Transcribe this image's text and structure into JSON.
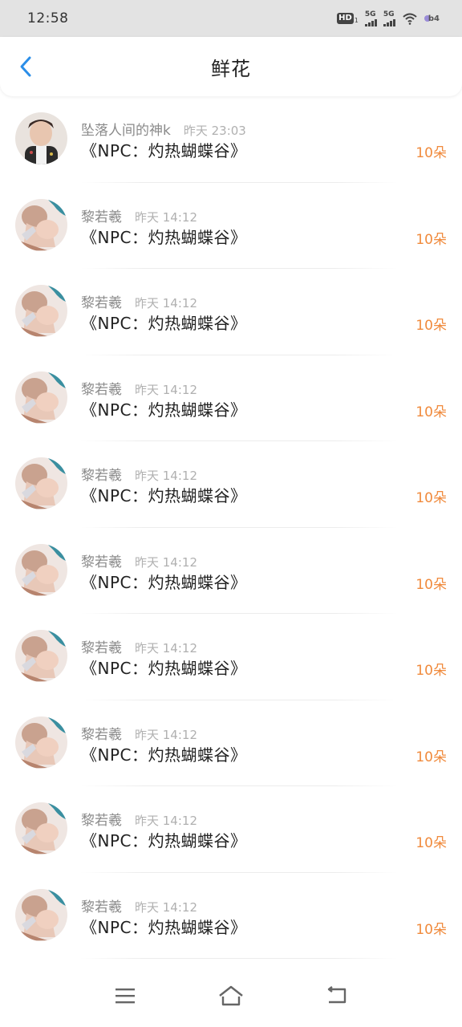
{
  "status_bar": {
    "time": "12:58",
    "hd_label": "HD",
    "hd_sub": "1",
    "signal1_label": "5G",
    "signal2_label": "5G",
    "battery_label": "b4"
  },
  "header": {
    "title": "鲜花",
    "back_icon": "chevron-left-icon"
  },
  "colors": {
    "accent_blue": "#2b8ee8",
    "count_orange": "#f08a3c",
    "username_gray": "#8a8a8a",
    "time_gray": "#b0b0b0"
  },
  "items": [
    {
      "username": "坠落人间的神k",
      "time": "昨天 23:03",
      "text": "《NPC：灼热蝴蝶谷》",
      "count": "10朵",
      "avatar": "avatar-1"
    },
    {
      "username": "黎若羲",
      "time": "昨天 14:12",
      "text": "《NPC：灼热蝴蝶谷》",
      "count": "10朵",
      "avatar": "avatar-2"
    },
    {
      "username": "黎若羲",
      "time": "昨天 14:12",
      "text": "《NPC：灼热蝴蝶谷》",
      "count": "10朵",
      "avatar": "avatar-2"
    },
    {
      "username": "黎若羲",
      "time": "昨天 14:12",
      "text": "《NPC：灼热蝴蝶谷》",
      "count": "10朵",
      "avatar": "avatar-2"
    },
    {
      "username": "黎若羲",
      "time": "昨天 14:12",
      "text": "《NPC：灼热蝴蝶谷》",
      "count": "10朵",
      "avatar": "avatar-2"
    },
    {
      "username": "黎若羲",
      "time": "昨天 14:12",
      "text": "《NPC：灼热蝴蝶谷》",
      "count": "10朵",
      "avatar": "avatar-2"
    },
    {
      "username": "黎若羲",
      "time": "昨天 14:12",
      "text": "《NPC：灼热蝴蝶谷》",
      "count": "10朵",
      "avatar": "avatar-2"
    },
    {
      "username": "黎若羲",
      "time": "昨天 14:12",
      "text": "《NPC：灼热蝴蝶谷》",
      "count": "10朵",
      "avatar": "avatar-2"
    },
    {
      "username": "黎若羲",
      "time": "昨天 14:12",
      "text": "《NPC：灼热蝴蝶谷》",
      "count": "10朵",
      "avatar": "avatar-2"
    },
    {
      "username": "黎若羲",
      "time": "昨天 14:12",
      "text": "《NPC：灼热蝴蝶谷》",
      "count": "10朵",
      "avatar": "avatar-2"
    }
  ],
  "nav": {
    "menu_icon": "menu-icon",
    "home_icon": "home-icon",
    "back_icon": "back-icon"
  }
}
